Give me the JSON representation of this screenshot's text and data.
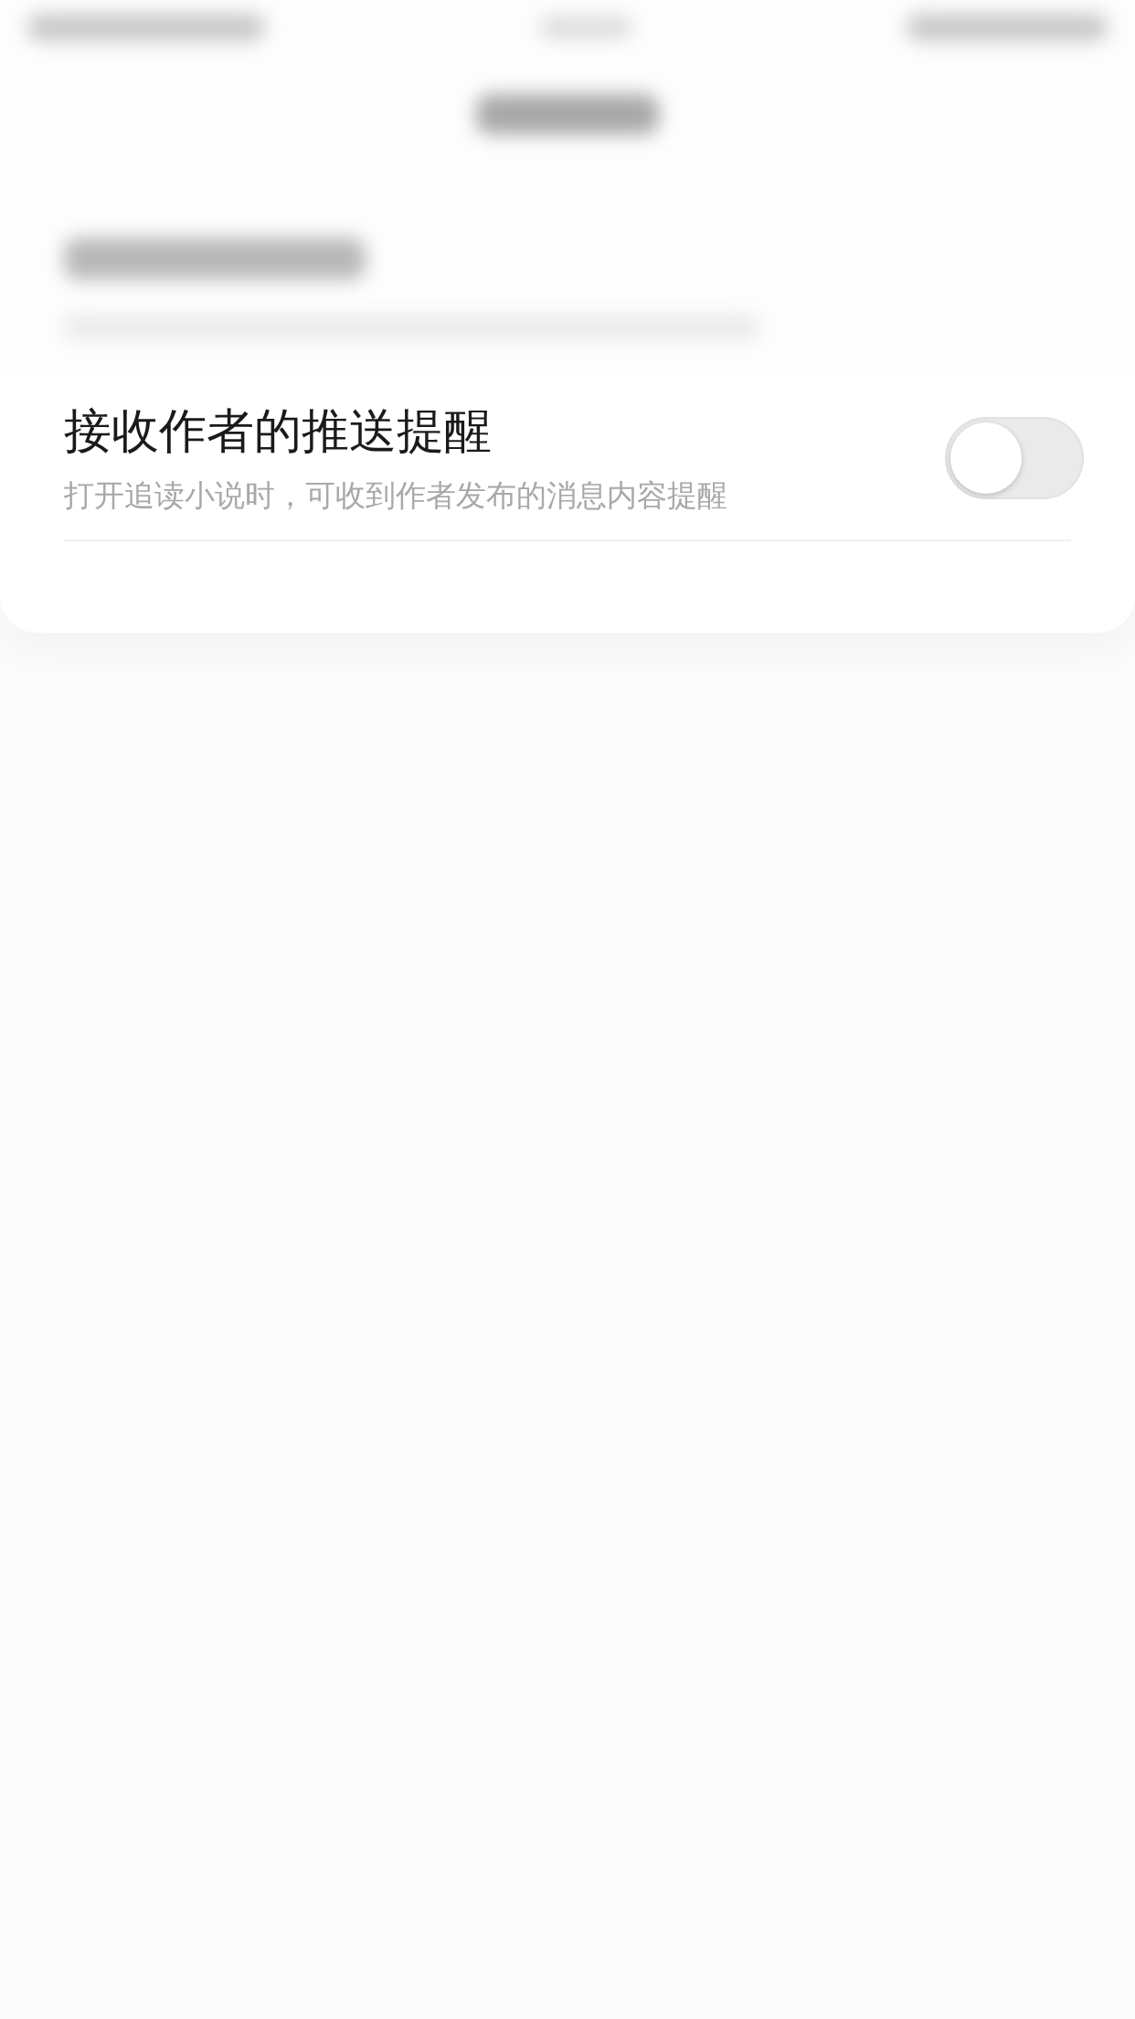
{
  "setting": {
    "title": "接收作者的推送提醒",
    "description": "打开追读小说时，可收到作者发布的消息内容提醒",
    "on": false
  }
}
